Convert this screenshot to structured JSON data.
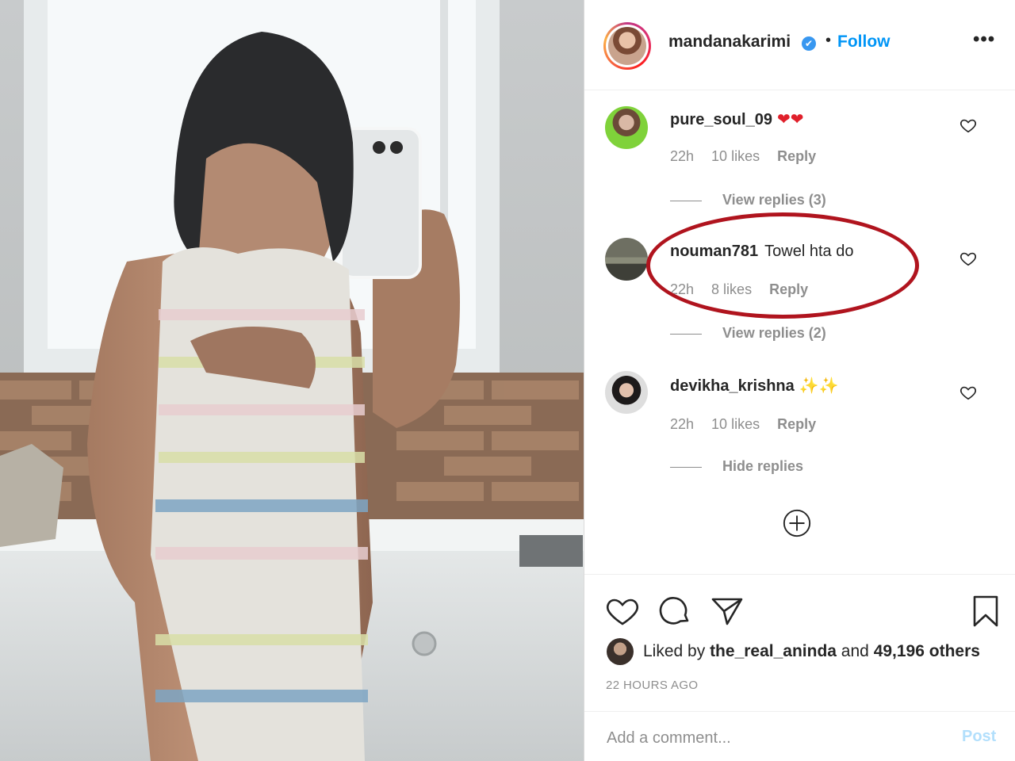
{
  "header": {
    "username": "mandanakarimi",
    "verified_mark": "✔",
    "separator": "•",
    "follow_label": "Follow",
    "more_label": "•••"
  },
  "comments": [
    {
      "username": "pure_soul_09",
      "text": "",
      "emoji": "❤❤",
      "time": "22h",
      "likes": "10 likes",
      "reply": "Reply",
      "replies_label": "View replies (3)",
      "avatar_icon": "user-avatar"
    },
    {
      "username": "nouman781",
      "text": "Towel hta do",
      "emoji": "",
      "time": "22h",
      "likes": "8 likes",
      "reply": "Reply",
      "replies_label": "View replies (2)",
      "avatar_icon": "user-avatar"
    },
    {
      "username": "devikha_krishna",
      "text": "",
      "emoji": "✨✨",
      "time": "22h",
      "likes": "10 likes",
      "reply": "Reply",
      "replies_label": "Hide replies",
      "avatar_icon": "user-avatar"
    }
  ],
  "actions": {
    "icons": [
      "heart-icon",
      "comment-icon",
      "share-icon",
      "bookmark-icon"
    ]
  },
  "likes": {
    "prefix": "Liked by ",
    "user": "the_real_aninda",
    "middle": " and ",
    "others": "49,196 others"
  },
  "timestamp": "22 HOURS AGO",
  "add_comment": {
    "placeholder": "Add a comment...",
    "post_label": "Post"
  },
  "colors": {
    "link": "#0095f6",
    "verified": "#3897f0",
    "highlight": "#b0141e",
    "muted": "#8e8e8e"
  }
}
